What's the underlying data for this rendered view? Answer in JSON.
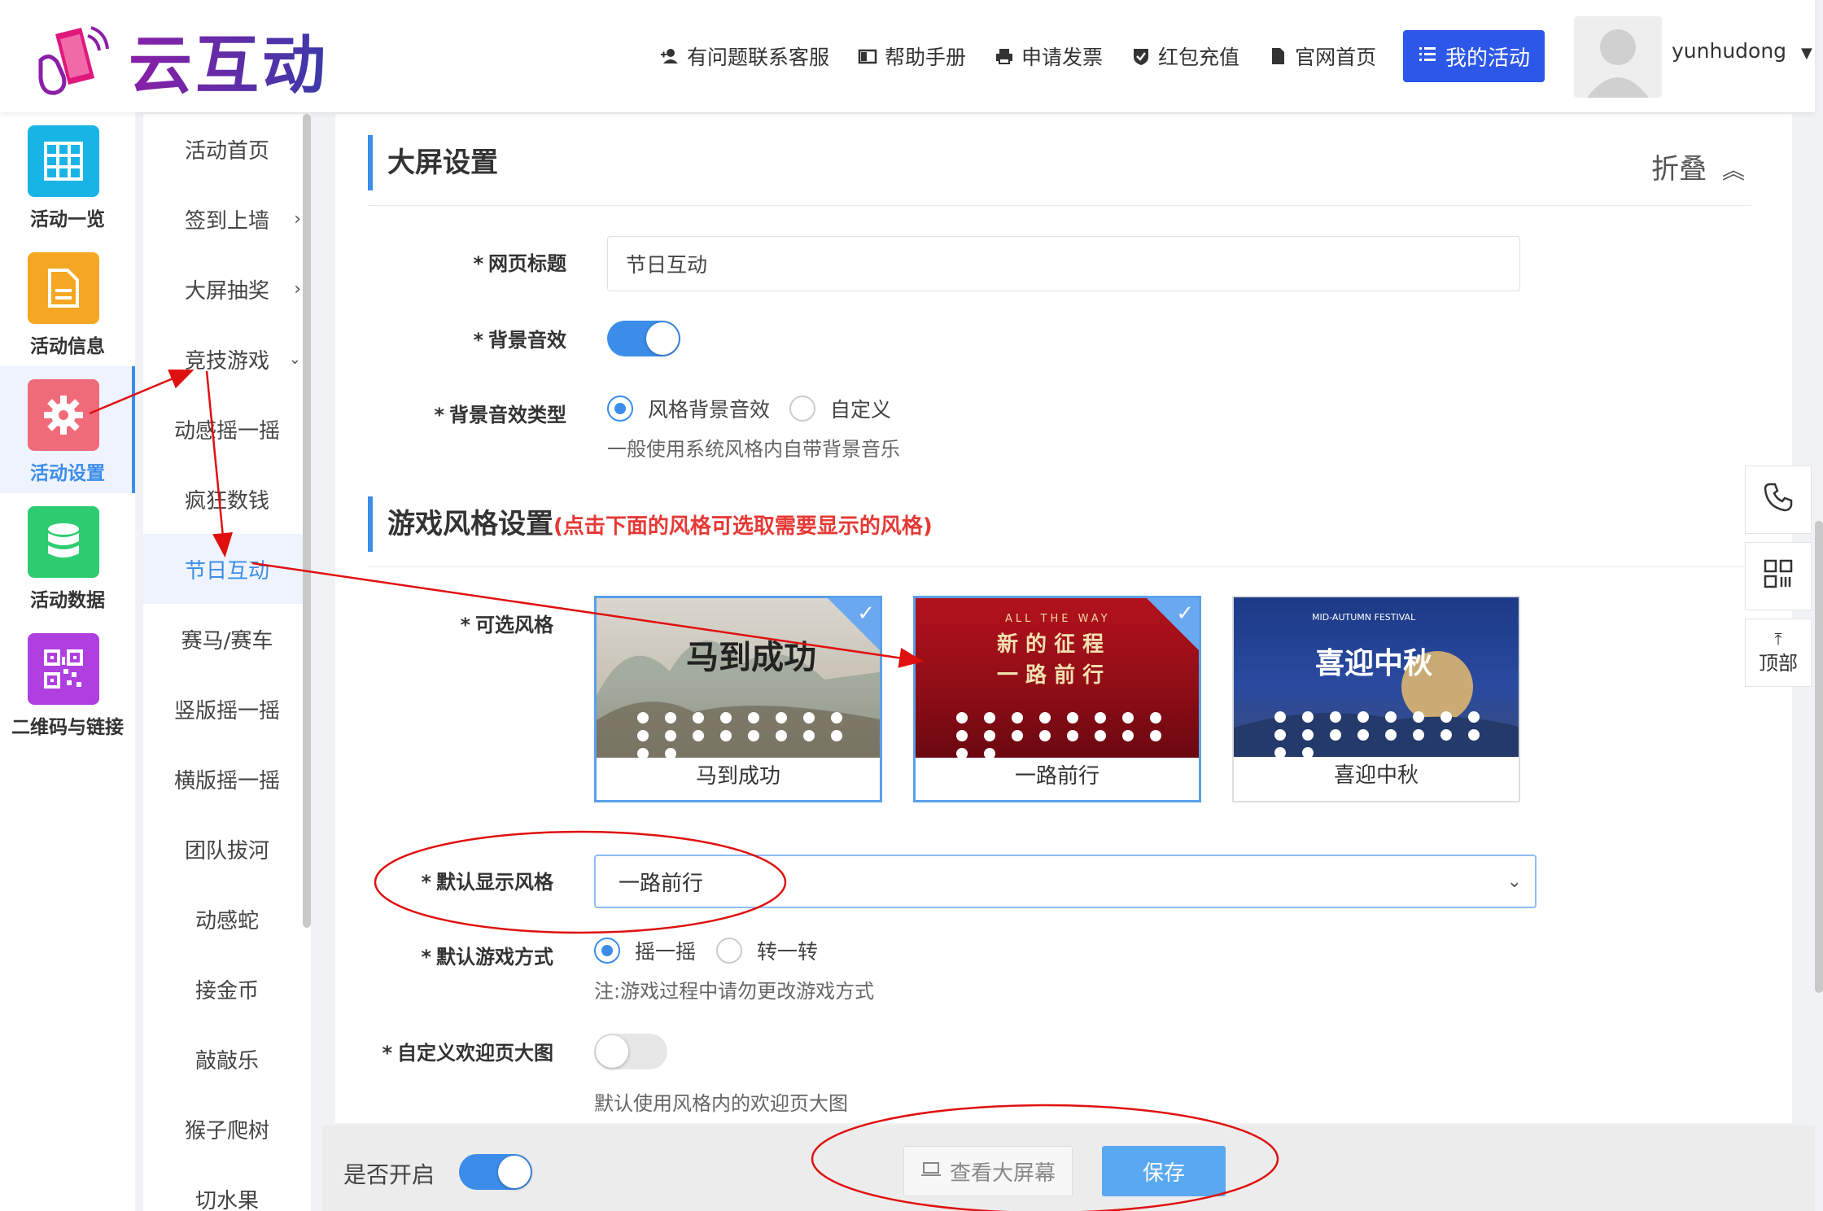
{
  "brand": {
    "name": "云互动"
  },
  "topnav": {
    "items": [
      {
        "label": "有问题联系客服",
        "icon": "add-user-icon"
      },
      {
        "label": "帮助手册",
        "icon": "book-icon"
      },
      {
        "label": "申请发票",
        "icon": "printer-icon"
      },
      {
        "label": "红包充值",
        "icon": "shield-check-icon"
      },
      {
        "label": "官网首页",
        "icon": "document-icon"
      }
    ],
    "my_activity": "我的活动",
    "username": "yunhudong"
  },
  "iconbar": {
    "items": [
      {
        "label": "活动一览",
        "color": "#19b4e6",
        "icon": "grid-icon"
      },
      {
        "label": "活动信息",
        "color": "#f5a623",
        "icon": "document-icon"
      },
      {
        "label": "活动设置",
        "color": "#f06b7a",
        "icon": "gear-icon"
      },
      {
        "label": "活动数据",
        "color": "#2ecc71",
        "icon": "database-icon"
      },
      {
        "label": "二维码与链接",
        "color": "#b03fe0",
        "icon": "qrcode-icon"
      }
    ]
  },
  "subbar": {
    "items": [
      "活动首页",
      "签到上墙",
      "大屏抽奖",
      "竞技游戏",
      "动感摇一摇",
      "疯狂数钱",
      "节日互动",
      "赛马/赛车",
      "竖版摇一摇",
      "横版摇一摇",
      "团队拔河",
      "动感蛇",
      "接金币",
      "敲敲乐",
      "猴子爬树",
      "切水果"
    ]
  },
  "screen_settings": {
    "title": "大屏设置",
    "collapse": "折叠",
    "page_title_label": "网页标题",
    "page_title_value": "节日互动",
    "bg_sound_label": "背景音效",
    "bg_sound_on": true,
    "bg_sound_type_label": "背景音效类型",
    "bg_sound_type_options": [
      "风格背景音效",
      "自定义"
    ],
    "bg_sound_type_hint": "一般使用系统风格内自带背景音乐"
  },
  "game_style": {
    "title": "游戏风格设置",
    "note": "(点击下面的风格可选取需要显示的风格)",
    "available_label": "可选风格",
    "styles": [
      {
        "name": "马到成功",
        "thumb_title": "马到成功",
        "selected": true
      },
      {
        "name": "一路前行",
        "thumb_title_line1": "新 的 征 程",
        "thumb_title_line2": "一 路 前 行",
        "thumb_caption": "ALL THE WAY",
        "selected": true
      },
      {
        "name": "喜迎中秋",
        "thumb_title": "喜迎中秋",
        "thumb_caption": "MID-AUTUMN FESTIVAL",
        "selected": false
      }
    ],
    "default_style_label": "默认显示风格",
    "default_style_value": "一路前行",
    "default_mode_label": "默认游戏方式",
    "default_mode_options": [
      "摇一摇",
      "转一转"
    ],
    "default_mode_hint": "注:游戏过程中请勿更改游戏方式",
    "custom_welcome_label": "自定义欢迎页大图",
    "custom_welcome_on": false,
    "custom_welcome_hint": "默认使用风格内的欢迎页大图"
  },
  "bottombar": {
    "enable_label": "是否开启",
    "enabled": true,
    "view_screen": "查看大屏幕",
    "save": "保存"
  },
  "floating": {
    "phone_icon": "phone-icon",
    "qr_icon": "qrcode-icon",
    "top_label": "顶部"
  },
  "annotation_color": "#e01010",
  "accent": "#3c8dea"
}
